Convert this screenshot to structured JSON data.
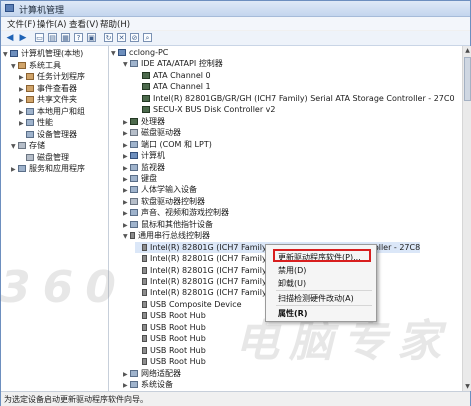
{
  "window": {
    "title": "计算机管理"
  },
  "menu": [
    "文件(F)",
    "操作(A)",
    "查看(V)",
    "帮助(H)"
  ],
  "left_tree": [
    {
      "label": "计算机管理(本地)",
      "depth": 0,
      "icon": "computer-icon",
      "tri": "▼"
    },
    {
      "label": "系统工具",
      "depth": 1,
      "icon": "tools-icon",
      "tri": "▼"
    },
    {
      "label": "任务计划程序",
      "depth": 2,
      "icon": "clock-icon",
      "tri": "▶"
    },
    {
      "label": "事件查看器",
      "depth": 2,
      "icon": "event-icon",
      "tri": "▶"
    },
    {
      "label": "共享文件夹",
      "depth": 2,
      "icon": "folder-icon",
      "tri": "▶"
    },
    {
      "label": "本地用户和组",
      "depth": 2,
      "icon": "users-icon",
      "tri": "▶"
    },
    {
      "label": "性能",
      "depth": 2,
      "icon": "performance-icon",
      "tri": "▶"
    },
    {
      "label": "设备管理器",
      "depth": 2,
      "icon": "device-manager-icon",
      "tri": ""
    },
    {
      "label": "存储",
      "depth": 1,
      "icon": "storage-icon",
      "tri": "▼"
    },
    {
      "label": "磁盘管理",
      "depth": 2,
      "icon": "disk-icon",
      "tri": ""
    },
    {
      "label": "服务和应用程序",
      "depth": 1,
      "icon": "services-icon",
      "tri": "▶"
    }
  ],
  "device_tree": [
    {
      "label": "cclong-PC",
      "depth": 0,
      "icon": "computer-icon",
      "tri": "▼"
    },
    {
      "label": "IDE ATA/ATAPI 控制器",
      "depth": 1,
      "icon": "ide-icon",
      "tri": "▼"
    },
    {
      "label": "ATA Channel 0",
      "depth": 2,
      "icon": "channel-icon",
      "tri": ""
    },
    {
      "label": "ATA Channel 1",
      "depth": 2,
      "icon": "channel-icon",
      "tri": ""
    },
    {
      "label": "Intel(R) 82801GB/GR/GH (ICH7 Family) Serial ATA Storage Controller - 27C0",
      "depth": 2,
      "icon": "controller-icon",
      "tri": ""
    },
    {
      "label": "SECU-X BUS Disk Controller v2",
      "depth": 2,
      "icon": "controller-icon",
      "tri": ""
    },
    {
      "label": "处理器",
      "depth": 1,
      "icon": "cpu-icon",
      "tri": "▶"
    },
    {
      "label": "磁盘驱动器",
      "depth": 1,
      "icon": "disk-icon",
      "tri": "▶"
    },
    {
      "label": "端口 (COM 和 LPT)",
      "depth": 1,
      "icon": "port-icon",
      "tri": "▶"
    },
    {
      "label": "计算机",
      "depth": 1,
      "icon": "computer-icon",
      "tri": "▶"
    },
    {
      "label": "监视器",
      "depth": 1,
      "icon": "monitor-icon",
      "tri": "▶"
    },
    {
      "label": "键盘",
      "depth": 1,
      "icon": "keyboard-icon",
      "tri": "▶"
    },
    {
      "label": "人体学输入设备",
      "depth": 1,
      "icon": "hid-icon",
      "tri": "▶"
    },
    {
      "label": "软盘驱动器控制器",
      "depth": 1,
      "icon": "floppy-icon",
      "tri": "▶"
    },
    {
      "label": "声音、视频和游戏控制器",
      "depth": 1,
      "icon": "sound-icon",
      "tri": "▶"
    },
    {
      "label": "鼠标和其他指针设备",
      "depth": 1,
      "icon": "mouse-icon",
      "tri": "▶"
    },
    {
      "label": "通用串行总线控制器",
      "depth": 1,
      "icon": "usb-icon",
      "tri": "▼"
    },
    {
      "label": "Intel(R) 82801G (ICH7 Family) USB Universal Host Controller - 27C8",
      "depth": 2,
      "icon": "usb-icon",
      "tri": "",
      "selected": true
    },
    {
      "label": "Intel(R) 82801G (ICH7 Family)",
      "depth": 2,
      "icon": "usb-icon",
      "tri": ""
    },
    {
      "label": "Intel(R) 82801G (ICH7 Family)",
      "depth": 2,
      "icon": "usb-icon",
      "tri": ""
    },
    {
      "label": "Intel(R) 82801G (ICH7 Family)",
      "depth": 2,
      "icon": "usb-icon",
      "tri": ""
    },
    {
      "label": "Intel(R) 82801G (ICH7 Family)",
      "depth": 2,
      "icon": "usb-icon",
      "tri": ""
    },
    {
      "label": "USB Composite Device",
      "depth": 2,
      "icon": "usb-icon",
      "tri": ""
    },
    {
      "label": "USB Root Hub",
      "depth": 2,
      "icon": "usb-icon",
      "tri": ""
    },
    {
      "label": "USB Root Hub",
      "depth": 2,
      "icon": "usb-icon",
      "tri": ""
    },
    {
      "label": "USB Root Hub",
      "depth": 2,
      "icon": "usb-icon",
      "tri": ""
    },
    {
      "label": "USB Root Hub",
      "depth": 2,
      "icon": "usb-icon",
      "tri": ""
    },
    {
      "label": "USB Root Hub",
      "depth": 2,
      "icon": "usb-icon",
      "tri": ""
    },
    {
      "label": "网络适配器",
      "depth": 1,
      "icon": "network-icon",
      "tri": "▶"
    },
    {
      "label": "系统设备",
      "depth": 1,
      "icon": "system-icon",
      "tri": "▶"
    }
  ],
  "context_menu": {
    "items": [
      "更新驱动程序软件(P)...",
      "禁用(D)",
      "卸载(U)",
      "扫描检测硬件改动(A)",
      "属性(R)"
    ],
    "highlighted_index": 0
  },
  "status": "为选定设备启动更新驱动程序软件向导。",
  "watermark": {
    "left": "360",
    "right": "电脑专家"
  },
  "colors": {
    "highlight": "#d81e1e",
    "selection": "#dbe7f8"
  }
}
